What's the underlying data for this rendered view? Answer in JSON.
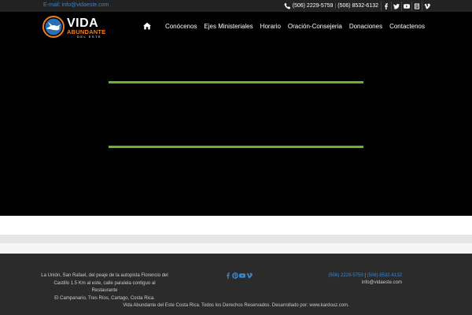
{
  "topbar": {
    "email": "E-mail: info@vidaeste.com",
    "phone1": "(506) 2229-5759",
    "separator": "|",
    "phone2": "(506) 8532-6132",
    "social_icons": [
      "facebook-icon",
      "twitter-icon",
      "youtube-icon",
      "blog-icon",
      "vimeo-icon"
    ]
  },
  "logo": {
    "word1": "VIDA",
    "word2": "ABUNDANTE",
    "word3": "DEL ESTE"
  },
  "nav": {
    "items": [
      {
        "label": "Conócenos"
      },
      {
        "label": "Ejes Ministeriales"
      },
      {
        "label": "Horario"
      },
      {
        "label": "Oración-Consejeria"
      },
      {
        "label": "Donaciones"
      },
      {
        "label": "Contactenos"
      }
    ]
  },
  "hero": {
    "accent_color": "#6ab22c"
  },
  "footer": {
    "address_line1": "La Unión, San Rafael, del peaje de la autopista Florencio del",
    "address_line2": "Castillo 1.5 Km al este, calle paralela contiguo al Restaurante",
    "address_line3": "El Campanario, Tres Ríos, Cartago, Costa Rica.",
    "phone1": "(506) 2229-5759",
    "bar": "|",
    "phone2": "(506) 8532-6132",
    "email": "info@vidaeste.com",
    "copyright": "Vida Abundante del Este Costa Rica. Todos los Derechos Reservados. Desarrollado por: www.kardouz.com."
  },
  "colors": {
    "link_blue": "#3b86c9",
    "brand_orange": "#f07d1d",
    "accent_green": "#6ab22c",
    "footer_bg": "#2b2b2b"
  }
}
